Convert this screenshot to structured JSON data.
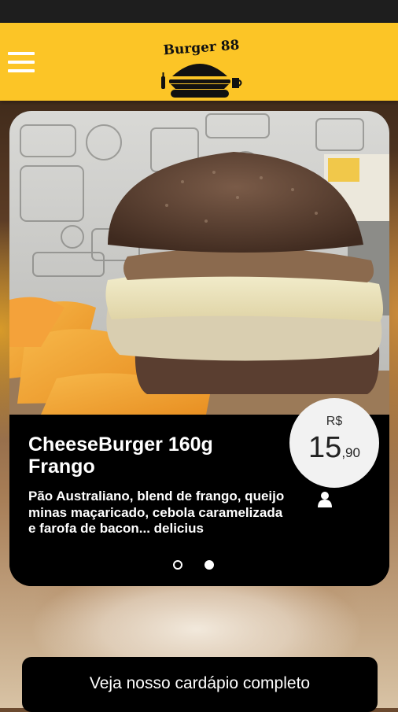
{
  "header": {
    "brand_name": "Burger 88",
    "menu_icon": "hamburger-menu-icon"
  },
  "carousel": {
    "product": {
      "name": "CheeseBurger 160g Frango",
      "description": "Pão Australiano, blend de frango, queijo minas maçaricado, cebola caramelizada e farofa de bacon... delicius",
      "currency": "R$",
      "price_main": "15",
      "price_cents": ",90",
      "serves_icon": "person-icon"
    },
    "slides_total": 2,
    "active_slide": 2
  },
  "cta": {
    "label": "Veja nosso cardápio completo"
  },
  "colors": {
    "header_bg": "#fcc526",
    "card_bg": "#000000",
    "price_circle_bg": "#f2f2f2"
  }
}
